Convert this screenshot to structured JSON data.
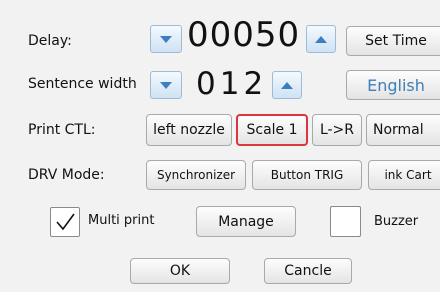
{
  "delay": {
    "label": "Delay:",
    "value": "00050",
    "set_button": "Set Time"
  },
  "sentence_width": {
    "label": "Sentence width",
    "value": "012",
    "language_button": "English"
  },
  "print_ctl": {
    "label": "Print CTL:",
    "options": [
      "left nozzle",
      "Scale 1",
      "L->R",
      "Normal"
    ],
    "selected": "Scale 1"
  },
  "drv_mode": {
    "label": "DRV Mode:",
    "options": [
      "Synchronizer",
      "Button TRIG",
      "ink Cart"
    ]
  },
  "multi_print": {
    "label": "Multi print",
    "checked": true
  },
  "manage_button": "Manage",
  "buzzer": {
    "label": "Buzzer",
    "checked": false
  },
  "ok_button": "OK",
  "cancel_button": "Cancle",
  "colors": {
    "accent_arrow": "#3d7ec2",
    "selected_border": "#d9363e",
    "language_text": "#3f7fb8"
  }
}
